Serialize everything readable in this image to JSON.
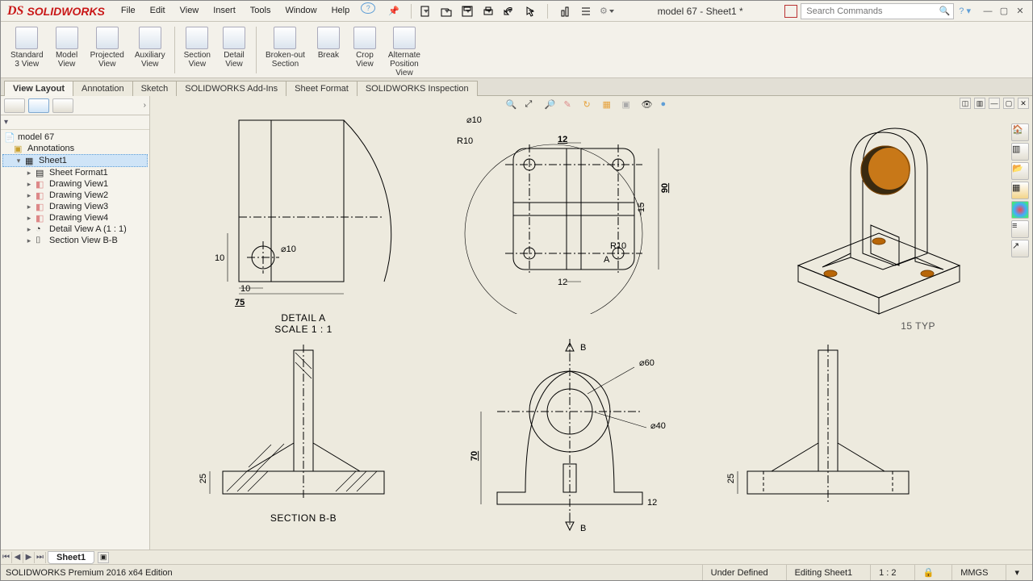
{
  "app": {
    "logo": "SOLIDWORKS",
    "title": "model 67 - Sheet1 *"
  },
  "menu": {
    "file": "File",
    "edit": "Edit",
    "view": "View",
    "insert": "Insert",
    "tools": "Tools",
    "window": "Window",
    "help": "Help"
  },
  "search": {
    "placeholder": "Search Commands"
  },
  "ribbon": {
    "std3": "Standard\n3 View",
    "model": "Model\nView",
    "proj": "Projected\nView",
    "aux": "Auxiliary\nView",
    "section": "Section\nView",
    "detail": "Detail\nView",
    "broken": "Broken-out\nSection",
    "break": "Break",
    "crop": "Crop\nView",
    "alt": "Alternate\nPosition\nView"
  },
  "tabs": {
    "viewlayout": "View Layout",
    "annotation": "Annotation",
    "sketch": "Sketch",
    "addins": "SOLIDWORKS Add-Ins",
    "sheetfmt": "Sheet Format",
    "inspect": "SOLIDWORKS Inspection"
  },
  "tree": {
    "root": "model 67",
    "annotations": "Annotations",
    "sheet1": "Sheet1",
    "sheetfmt1": "Sheet Format1",
    "dv1": "Drawing View1",
    "dv2": "Drawing View2",
    "dv3": "Drawing View3",
    "dv4": "Drawing View4",
    "detaila": "Detail View A (1 : 1)",
    "sectionbb": "Section View B-B"
  },
  "labels": {
    "detailA1": "DETAIL A",
    "detailA2": "SCALE 1 : 1",
    "sectionBB": "SECTION B-B",
    "iso": "15 TYP",
    "B": "B",
    "A": "A"
  },
  "dims": {
    "d75": "75",
    "d10a": "10",
    "d10b": "10",
    "dia10a": "10",
    "dia10b": "10",
    "r10a": "R10",
    "r10b": "R10",
    "d12a": "12",
    "d12b": "12",
    "d15": "15",
    "d90": "90",
    "d25a": "25",
    "d25b": "25",
    "d70": "70",
    "d12c": "12",
    "dia60": "60",
    "dia40": "40"
  },
  "sheet": {
    "tab": "Sheet1"
  },
  "status": {
    "edition": "SOLIDWORKS Premium 2016 x64 Edition",
    "under": "Under Defined",
    "editing": "Editing Sheet1",
    "scale": "1 : 2",
    "units": "MMGS"
  },
  "colors": {
    "accent": "#cfe4f7",
    "model": "#e88a1a",
    "modelDark": "#b86608"
  }
}
